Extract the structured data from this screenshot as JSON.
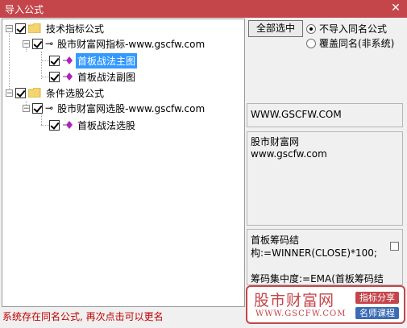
{
  "window": {
    "title": "导入公式",
    "close_glyph": "✕"
  },
  "tree": {
    "groups": [
      {
        "label": "技术指标公式",
        "source": "股市财富网指标-www.gscfw.com",
        "items": [
          "首板战法主图",
          "首板战法副图"
        ]
      },
      {
        "label": "条件选股公式",
        "source": "股市财富网选股-www.gscfw.com",
        "items": [
          "首板战法选股"
        ]
      }
    ]
  },
  "controls": {
    "select_all": "全部选中",
    "radio_options": [
      "不导入同名公式",
      "覆盖同名(非系统)"
    ],
    "selected_radio": 0
  },
  "panels": {
    "url": "WWW.GSCFW.COM",
    "desc_line1": "股市财富网",
    "desc_line2": "www.gscfw.com",
    "formula_text": "首板筹码结构:=WINNER(CLOSE)*100;\n\n筹码集中度:=EMA(首板筹码结"
  },
  "status": "系统存在同名公式, 再次点击可以更名",
  "watermark": {
    "site": "股市财富网",
    "url": "WWW.GSCFW.COM",
    "tag1": "指标分享",
    "tag2": "名师课程"
  },
  "colors": {
    "title_bar": "#c4464b",
    "selection": "#3399ff",
    "status_text": "#c00000"
  }
}
